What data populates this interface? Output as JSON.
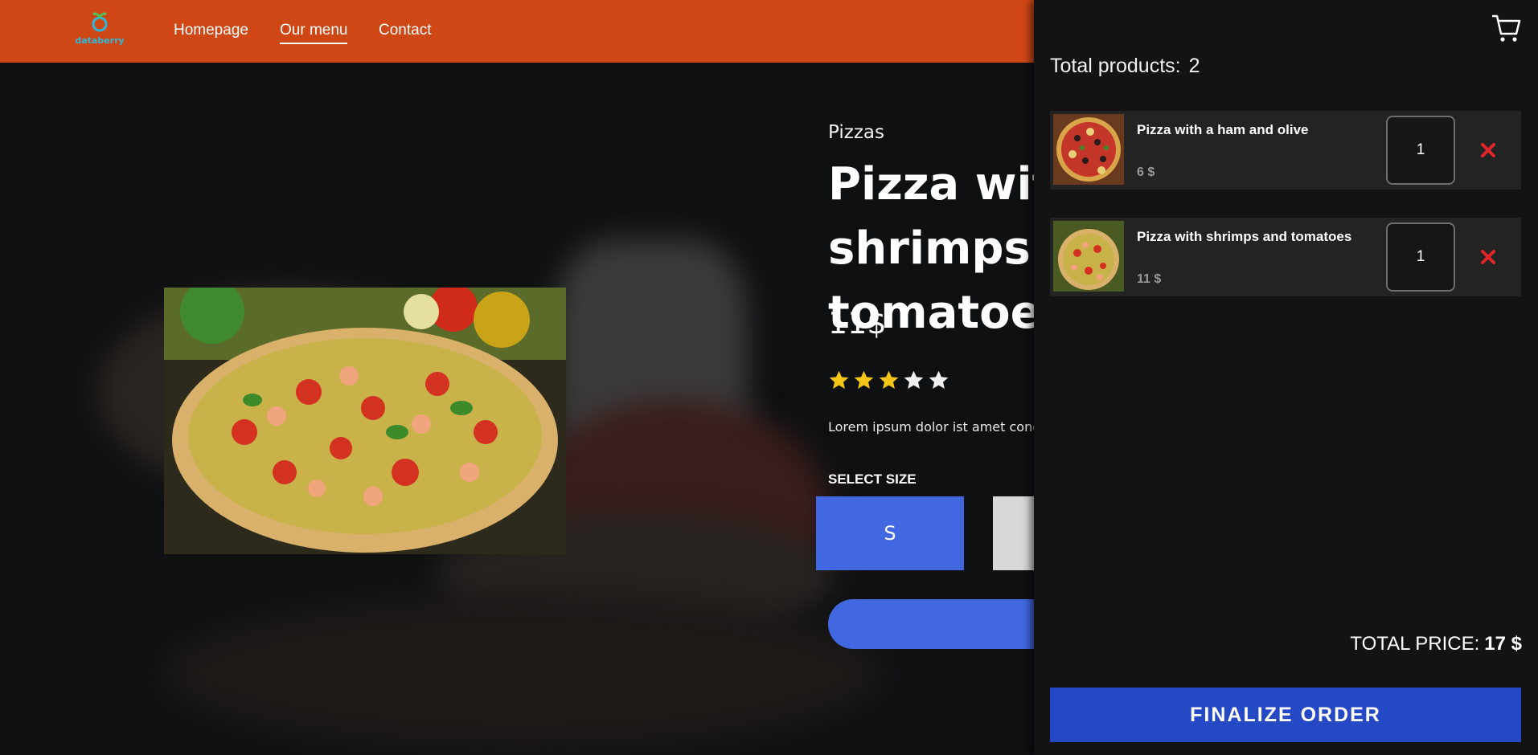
{
  "header": {
    "logo_text": "databerry",
    "nav": [
      {
        "label": "Homepage"
      },
      {
        "label": "Our menu"
      },
      {
        "label": "Contact"
      }
    ]
  },
  "product": {
    "category": "Pizzas",
    "title": "Pizza with shrimps and tomatoes",
    "price": "11$",
    "rating": 3,
    "rating_max": 5,
    "description": "Lorem ipsum dolor ist amet conc",
    "select_size_label": "SELECT SIZE",
    "sizes": [
      "S"
    ],
    "selected_size": "S"
  },
  "cart": {
    "total_products_label": "Total products:",
    "total_products_count": "2",
    "items": [
      {
        "name": "Pizza with a ham and olive",
        "price": "6 $",
        "quantity": "1"
      },
      {
        "name": "Pizza with shrimps and tomatoes",
        "price": "11 $",
        "quantity": "1"
      }
    ],
    "total_price_label": "TOTAL PRICE:",
    "total_price_value": "17 $",
    "finalize_label": "FINALIZE ORDER"
  },
  "colors": {
    "header": "#d04716",
    "accent_blue": "#4168e0",
    "finalize_blue": "#2549c5",
    "star_filled": "#f5c518",
    "star_empty": "#f0f0f0",
    "remove_red": "#e0262b"
  },
  "icons": [
    "logo-icon",
    "cart-icon",
    "star-icon",
    "close-icon"
  ]
}
